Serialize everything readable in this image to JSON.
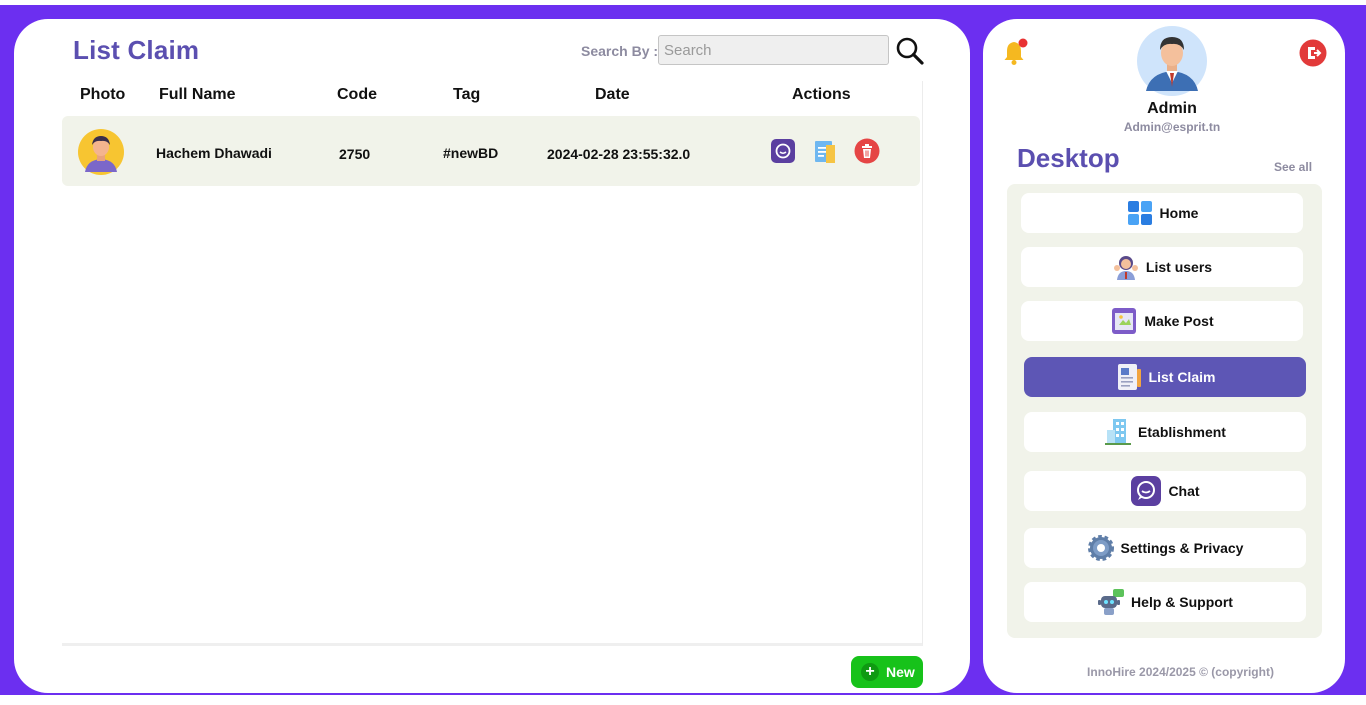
{
  "main": {
    "title": "List Claim",
    "search_label": "Search By :",
    "search_placeholder": "Search",
    "columns": [
      "Photo",
      "Full Name",
      "Code",
      "Tag",
      "Date",
      "Actions"
    ],
    "rows": [
      {
        "full_name": "Hachem Dhawadi",
        "code": "2750",
        "tag": "#newBD",
        "date": "2024-02-28 23:55:32.0"
      }
    ],
    "new_button": "New"
  },
  "sidebar": {
    "admin_name": "Admin",
    "admin_email": "Admin@esprit.tn",
    "section_title": "Desktop",
    "see_all": "See all",
    "items": [
      {
        "label": "Home",
        "icon": "home-grid-icon"
      },
      {
        "label": "List users",
        "icon": "users-icon"
      },
      {
        "label": "Make Post",
        "icon": "post-icon"
      },
      {
        "label": "List Claim",
        "icon": "claim-icon"
      },
      {
        "label": "Etablishment",
        "icon": "building-icon"
      },
      {
        "label": "Chat",
        "icon": "chat-icon"
      },
      {
        "label": "Settings & Privacy",
        "icon": "gear-icon"
      },
      {
        "label": "Help & Support",
        "icon": "robot-support-icon"
      }
    ],
    "active_item": "List Claim",
    "footer": "InnoHire 2024/2025 © (copyright)"
  },
  "colors": {
    "frame": "#6c2ff0",
    "accent": "#5b4fb0",
    "active_menu": "#5d56b5",
    "new_button": "#17c21a",
    "row_bg": "#f1f3ea"
  }
}
